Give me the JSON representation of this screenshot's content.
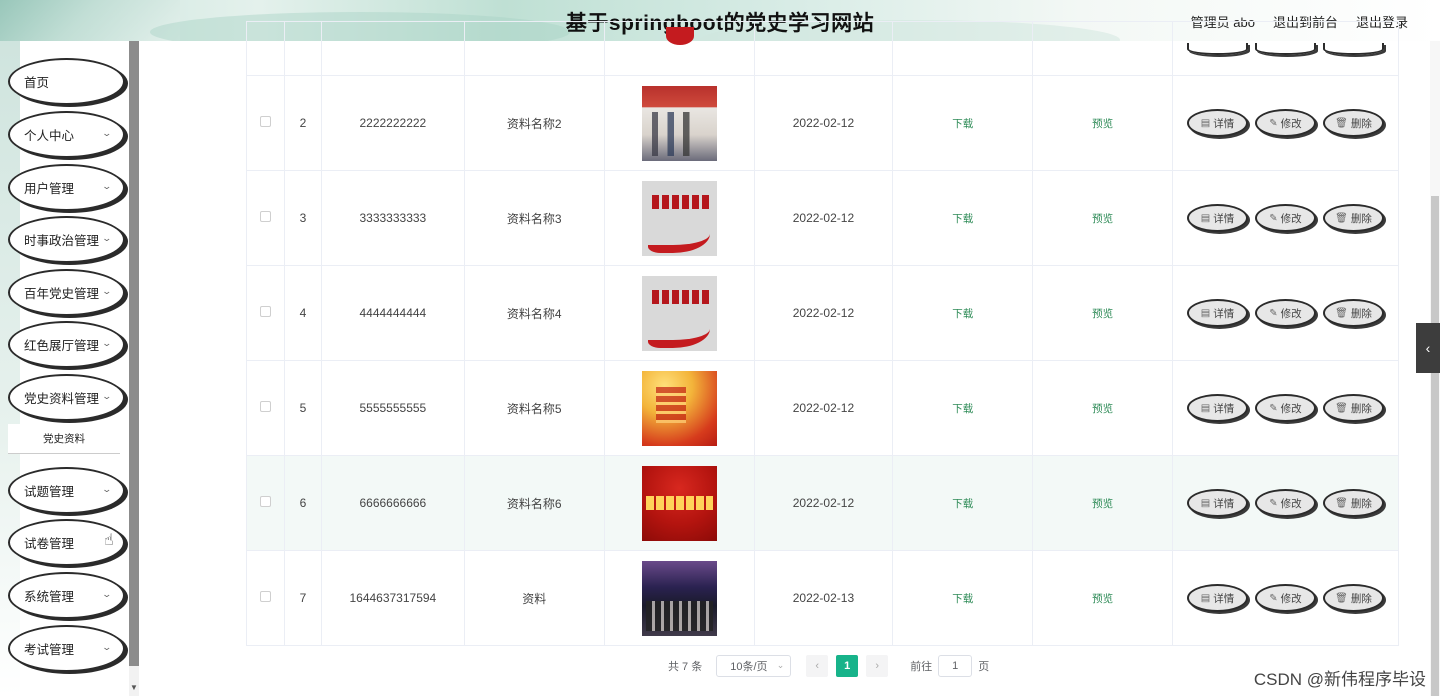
{
  "header": {
    "title": "基于springboot的党史学习网站",
    "admin": "管理员 abo",
    "to_front": "退出到前台",
    "logout": "退出登录"
  },
  "sidebar": {
    "items": [
      {
        "label": "首页",
        "expandable": false
      },
      {
        "label": "个人中心",
        "expandable": true
      },
      {
        "label": "用户管理",
        "expandable": true
      },
      {
        "label": "时事政治管理",
        "expandable": true
      },
      {
        "label": "百年党史管理",
        "expandable": true
      },
      {
        "label": "红色展厅管理",
        "expandable": true
      },
      {
        "label": "党史资料管理",
        "expandable": true
      },
      {
        "label": "试题管理",
        "expandable": true
      },
      {
        "label": "试卷管理",
        "expandable": false
      },
      {
        "label": "系统管理",
        "expandable": true
      },
      {
        "label": "考试管理",
        "expandable": true
      }
    ],
    "submenu": "党史资料"
  },
  "table": {
    "rows": [
      {
        "index": "2",
        "code": "2222222222",
        "name": "资料名称2",
        "date": "2022-02-12",
        "download": "下载",
        "preview": "预览",
        "image": "t-people"
      },
      {
        "index": "3",
        "code": "3333333333",
        "name": "资料名称3",
        "date": "2022-02-12",
        "download": "下载",
        "preview": "预览",
        "image": "t-banner"
      },
      {
        "index": "4",
        "code": "4444444444",
        "name": "资料名称4",
        "date": "2022-02-12",
        "download": "下载",
        "preview": "预览",
        "image": "t-banner"
      },
      {
        "index": "5",
        "code": "5555555555",
        "name": "资料名称5",
        "date": "2022-02-12",
        "download": "下载",
        "preview": "预览",
        "image": "t-yellow"
      },
      {
        "index": "6",
        "code": "6666666666",
        "name": "资料名称6",
        "date": "2022-02-12",
        "download": "下载",
        "preview": "预览",
        "image": "t-red"
      },
      {
        "index": "7",
        "code": "1644637317594",
        "name": "资料",
        "date": "2022-02-13",
        "download": "下载",
        "preview": "预览",
        "image": "t-stage"
      }
    ],
    "actions": {
      "detail": "详情",
      "edit": "修改",
      "delete": "删除"
    }
  },
  "pagination": {
    "total": "共 7 条",
    "page_size": "10条/页",
    "current_page": "1",
    "goto_label": "前往",
    "goto_value": "1",
    "page_unit": "页",
    "prev": "‹",
    "next": "›"
  },
  "watermark": "CSDN @新伟程序毕设",
  "colors": {
    "accent": "#17b38a",
    "link": "#2e8b57"
  }
}
